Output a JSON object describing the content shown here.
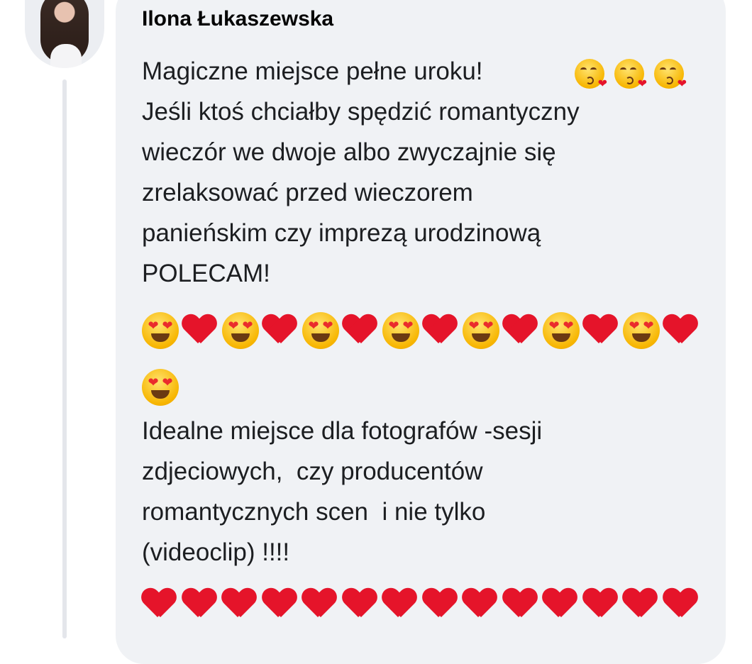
{
  "comment": {
    "author": "Ilona Łukaszewska",
    "paragraph1_lines": [
      "Magiczne miejsce pełne uroku!",
      "Jeśli ktoś chciałby spędzić romantyczny",
      "wieczór we dwoje albo zwyczajnie się",
      "zrelaksować przed wieczorem",
      "panieńskim czy imprezą urodzinową",
      "POLECAM!"
    ],
    "paragraph2_lines": [
      "Idealne miejsce dla fotografów -sesji",
      "zdjeciowych,  czy producentów",
      "romantycznych scen  i nie tylko",
      "(videoclip) !!!!"
    ],
    "emoji": {
      "line1_suffix": [
        "kissing-heart-icon",
        "kissing-heart-icon",
        "kissing-heart-icon"
      ],
      "row1": [
        "heart-eyes-icon",
        "red-heart-icon",
        "heart-eyes-icon",
        "red-heart-icon",
        "heart-eyes-icon",
        "red-heart-icon",
        "heart-eyes-icon",
        "red-heart-icon",
        "heart-eyes-icon",
        "red-heart-icon",
        "heart-eyes-icon",
        "red-heart-icon",
        "heart-eyes-icon",
        "red-heart-icon"
      ],
      "row2": [
        "heart-eyes-icon"
      ],
      "row3": [
        "red-heart-icon",
        "red-heart-icon",
        "red-heart-icon",
        "red-heart-icon",
        "red-heart-icon",
        "red-heart-icon",
        "red-heart-icon",
        "red-heart-icon",
        "red-heart-icon",
        "red-heart-icon",
        "red-heart-icon",
        "red-heart-icon",
        "red-heart-icon",
        "red-heart-icon"
      ]
    }
  },
  "colors": {
    "bubble": "#f0f2f5",
    "text": "#1c1e21",
    "heart": "#e5142a"
  }
}
